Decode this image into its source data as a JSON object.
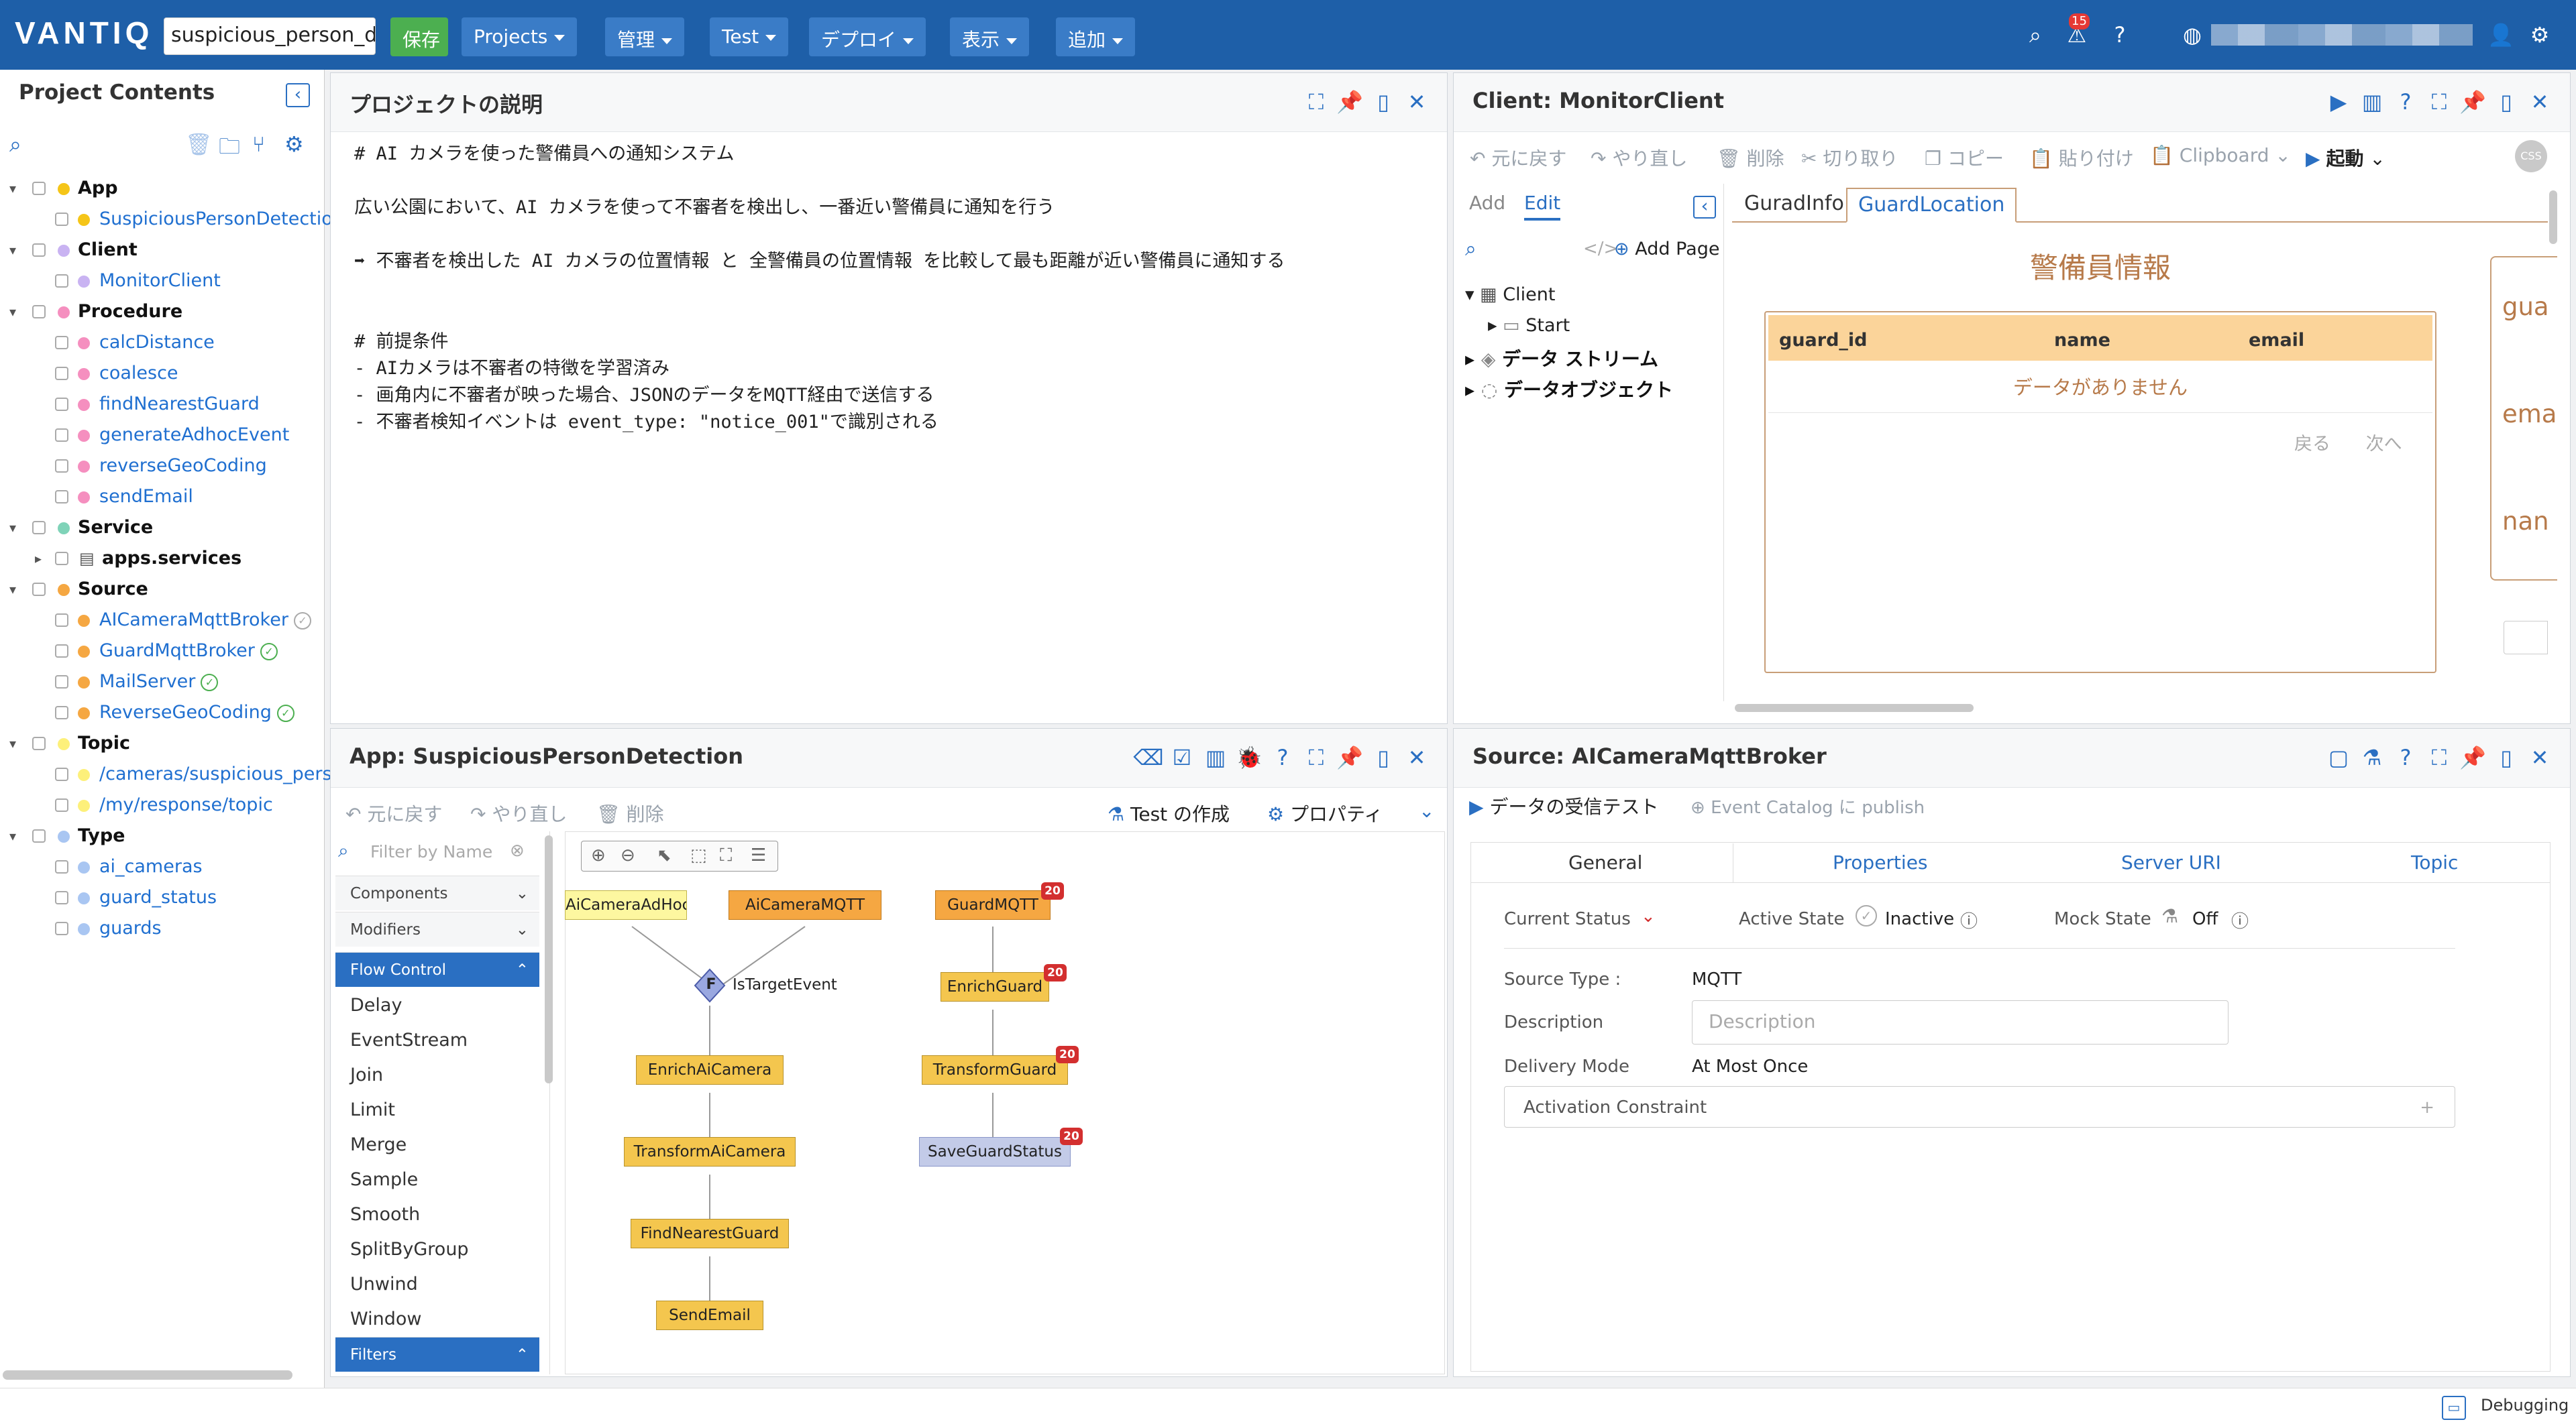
{
  "topbar": {
    "logo": "VANTIQ",
    "project_name": "suspicious_person_de",
    "save_label": "保存",
    "menus": [
      "Projects",
      "管理",
      "Test",
      "デプロイ",
      "表示",
      "追加"
    ],
    "notification_count": "15",
    "icons": [
      "search-icon",
      "alert-icon",
      "help-icon",
      "globe-icon",
      "user-icon",
      "gear-icon"
    ]
  },
  "left": {
    "title": "Project Contents",
    "groups": [
      {
        "label": "App",
        "color": "#f5c518",
        "items": [
          {
            "label": "SuspiciousPersonDetection",
            "color": "#f5c518"
          }
        ]
      },
      {
        "label": "Client",
        "color": "#c9b3f2",
        "items": [
          {
            "label": "MonitorClient",
            "color": "#c9b3f2"
          }
        ]
      },
      {
        "label": "Procedure",
        "color": "#f58fbf",
        "items": [
          {
            "label": "calcDistance",
            "color": "#f58fbf"
          },
          {
            "label": "coalesce",
            "color": "#f58fbf"
          },
          {
            "label": "findNearestGuard",
            "color": "#f58fbf"
          },
          {
            "label": "generateAdhocEvent",
            "color": "#f58fbf"
          },
          {
            "label": "reverseGeoCoding",
            "color": "#f58fbf"
          },
          {
            "label": "sendEmail",
            "color": "#f58fbf"
          }
        ]
      },
      {
        "label": "Service",
        "color": "#7fd3b8",
        "items": [
          {
            "label": "apps.services",
            "color": ""
          }
        ]
      },
      {
        "label": "Source",
        "color": "#f5a742",
        "items": [
          {
            "label": "AICameraMqttBroker",
            "color": "#f5a742",
            "status": "neutral"
          },
          {
            "label": "GuardMqttBroker",
            "color": "#f5a742",
            "status": "ok"
          },
          {
            "label": "MailServer",
            "color": "#f5a742",
            "status": "ok"
          },
          {
            "label": "ReverseGeoCoding",
            "color": "#f5a742",
            "status": "ok"
          }
        ]
      },
      {
        "label": "Topic",
        "color": "#fdf07a",
        "items": [
          {
            "label": "/cameras/suspicious_persor",
            "color": "#fdf07a"
          },
          {
            "label": "/my/response/topic",
            "color": "#fdf07a"
          }
        ]
      },
      {
        "label": "Type",
        "color": "#a9c6f2",
        "items": [
          {
            "label": "ai_cameras",
            "color": "#a9c6f2"
          },
          {
            "label": "guard_status",
            "color": "#a9c6f2"
          },
          {
            "label": "guards",
            "color": "#a9c6f2"
          }
        ]
      }
    ]
  },
  "desc": {
    "title": "プロジェクトの説明",
    "lines": [
      "# AI カメラを使った警備員への通知システム",
      "",
      "広い公園において、AI カメラを使って不審者を検出し、一番近い警備員に通知を行う",
      "",
      "➡ 不審者を検出した AI カメラの位置情報 と 全警備員の位置情報 を比較して最も距離が近い警備員に通知する",
      "",
      "",
      "# 前提条件",
      "- AIカメラは不審者の特徴を学習済み",
      "- 画角内に不審者が映った場合、JSONのデータをMQTT経由で送信する",
      "- 不審者検知イベントは event_type: \"notice_001\"で識別される"
    ]
  },
  "client": {
    "title": "Client: MonitorClient",
    "toolbar": [
      "元に戻す",
      "やり直し",
      "削除",
      "切り取り",
      "コピー",
      "貼り付け",
      "Clipboard",
      "起動"
    ],
    "css_badge": "CSS",
    "tabs": [
      "Add",
      "Edit"
    ],
    "add_page": "Add Page",
    "tree": [
      "Client",
      "Start",
      "データ ストリーム",
      "データオブジェクト"
    ],
    "canvas_tabs": [
      "GuradInfo",
      "GuardLocation"
    ],
    "guard_title": "警備員情報",
    "columns": [
      "guard_id",
      "name",
      "email"
    ],
    "empty": "データがありません",
    "pager": [
      "戻る",
      "次へ"
    ],
    "peek": [
      "gua",
      "ema",
      "nan"
    ]
  },
  "app": {
    "title": "App: SuspiciousPersonDetection",
    "toolbar": [
      "元に戻す",
      "やり直し",
      "削除"
    ],
    "test_label": "Test の作成",
    "props_label": "プロパティ",
    "filter_placeholder": "Filter by Name",
    "palette_sections": [
      "Components",
      "Modifiers",
      "Flow Control",
      "Filters"
    ],
    "flow_items": [
      "Delay",
      "EventStream",
      "Join",
      "Limit",
      "Merge",
      "Sample",
      "Smooth",
      "SplitByGroup",
      "Unwind",
      "Window"
    ],
    "nodes": {
      "n1": "AiCameraAdHoc",
      "n2": "AiCameraMQTT",
      "n3": "IsTargetEvent",
      "n4": "EnrichAiCamera",
      "n5": "TransformAiCamera",
      "n6": "FindNearestGuard",
      "n7": "SendEmail",
      "n8": "GuardMQTT",
      "n9": "EnrichGuard",
      "n10": "TransformGuard",
      "n11": "SaveGuardStatus"
    },
    "filter_glyph": "F",
    "badge": "20"
  },
  "source": {
    "title": "Source: AICameraMqttBroker",
    "actions": [
      "データの受信テスト",
      "Event Catalog に publish"
    ],
    "tabs": [
      "General",
      "Properties",
      "Server URI",
      "Topic"
    ],
    "current_status": "Current Status",
    "active_state": "Active State",
    "active_value": "Inactive",
    "mock_state": "Mock State",
    "mock_value": "Off",
    "source_type_label": "Source Type :",
    "source_type_value": "MQTT",
    "description_label": "Description",
    "description_placeholder": "Description",
    "delivery_mode_label": "Delivery Mode",
    "delivery_mode_value": "At Most Once",
    "activation_label": "Activation Constraint"
  },
  "footer": {
    "debugging": "Debugging"
  }
}
